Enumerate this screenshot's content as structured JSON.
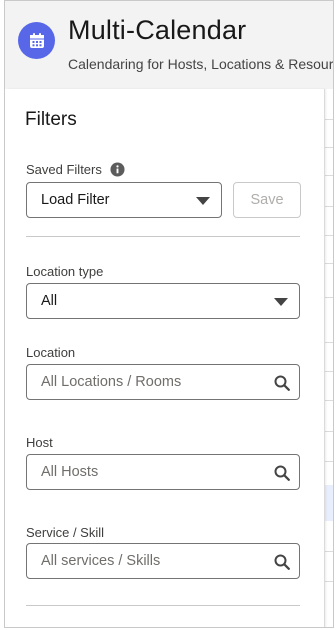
{
  "header": {
    "title": "Multi-Calendar",
    "subtitle": "Calendaring for Hosts, Locations & Resources",
    "icon": "calendar-icon",
    "icon_bg": "#5867e8"
  },
  "filters": {
    "title": "Filters",
    "saved_filters": {
      "label": "Saved Filters",
      "info_icon": "info-icon",
      "value": "Load Filter",
      "save_label": "Save"
    },
    "location_type": {
      "label": "Location type",
      "value": "All"
    },
    "location": {
      "label": "Location",
      "placeholder": "All Locations / Rooms"
    },
    "host": {
      "label": "Host",
      "placeholder": "All Hosts"
    },
    "service": {
      "label": "Service / Skill",
      "placeholder": "All services / Skills"
    }
  },
  "colors": {
    "accent": "#5867e8",
    "header_bg": "#f3f3f3",
    "border": "#747474"
  }
}
